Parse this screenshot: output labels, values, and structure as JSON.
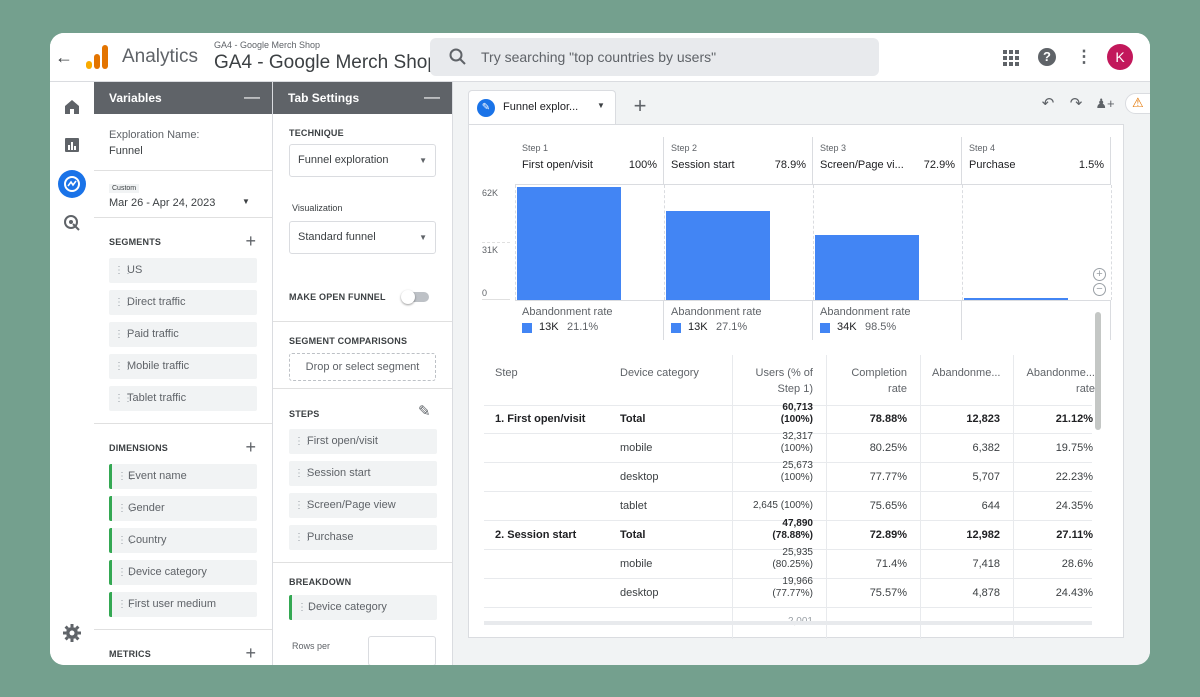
{
  "header": {
    "app_name": "Analytics",
    "property_small": "GA4 - Google Merch Shop",
    "property_big": "GA4 - Google Merch Shop",
    "search_placeholder": "Try searching \"top countries by users\"",
    "avatar_letter": "K"
  },
  "variables": {
    "title": "Variables",
    "exploration_label": "Exploration Name:",
    "exploration_name": "Funnel",
    "date_tag": "Custom",
    "date_range": "Mar 26 - Apr 24, 2023",
    "segments_label": "SEGMENTS",
    "segments": [
      "US",
      "Direct traffic",
      "Paid traffic",
      "Mobile traffic",
      "Tablet traffic"
    ],
    "dimensions_label": "DIMENSIONS",
    "dimensions": [
      "Event name",
      "Gender",
      "Country",
      "Device category",
      "First user medium"
    ],
    "metrics_label": "METRICS"
  },
  "tab_settings": {
    "title": "Tab Settings",
    "technique_label": "TECHNIQUE",
    "technique_value": "Funnel exploration",
    "visualization_label": "Visualization",
    "visualization_value": "Standard funnel",
    "open_funnel_label": "MAKE OPEN FUNNEL",
    "segment_comparisons_label": "SEGMENT COMPARISONS",
    "drop_segment": "Drop or select segment",
    "steps_label": "STEPS",
    "steps": [
      "First open/visit",
      "Session start",
      "Screen/Page view",
      "Purchase"
    ],
    "breakdown_label": "BREAKDOWN",
    "breakdown_value": "Device category",
    "rows_label": "Rows per"
  },
  "main": {
    "tab_label": "Funnel explor...",
    "funnel_steps": [
      {
        "step": "Step 1",
        "name": "First open/visit",
        "pct": "100%"
      },
      {
        "step": "Step 2",
        "name": "Session start",
        "pct": "78.9%"
      },
      {
        "step": "Step 3",
        "name": "Screen/Page vi...",
        "pct": "72.9%"
      },
      {
        "step": "Step 4",
        "name": "Purchase",
        "pct": "1.5%"
      }
    ],
    "y_ticks": [
      "62K",
      "31K",
      "0"
    ],
    "abandonment_label": "Abandonment rate",
    "abandonment": [
      {
        "count": "13K",
        "rate": "21.1%"
      },
      {
        "count": "13K",
        "rate": "27.1%"
      },
      {
        "count": "34K",
        "rate": "98.5%"
      }
    ],
    "table_headers": [
      "Step",
      "Device category",
      "Users (% of",
      "Step 1)",
      "Completion",
      "rate",
      "Abandonme...",
      "Abandonme...",
      "rate"
    ],
    "table_rows": [
      {
        "step": "1. First open/visit",
        "device": "Total",
        "users1": "60,713",
        "users2": "(100%)",
        "completion": "78.88%",
        "aband": "12,823",
        "aband_rate": "21.12%"
      },
      {
        "step": "",
        "device": "mobile",
        "users1": "32,317",
        "users2": "(100%)",
        "completion": "80.25%",
        "aband": "6,382",
        "aband_rate": "19.75%"
      },
      {
        "step": "",
        "device": "desktop",
        "users1": "25,673",
        "users2": "(100%)",
        "completion": "77.77%",
        "aband": "5,707",
        "aband_rate": "22.23%"
      },
      {
        "step": "",
        "device": "tablet",
        "users1": "2,645 (100%)",
        "users2": "",
        "completion": "75.65%",
        "aband": "644",
        "aband_rate": "24.35%"
      },
      {
        "step": "2. Session start",
        "device": "Total",
        "users1": "47,890",
        "users2": "(78.88%)",
        "completion": "72.89%",
        "aband": "12,982",
        "aband_rate": "27.11%"
      },
      {
        "step": "",
        "device": "mobile",
        "users1": "25,935",
        "users2": "(80.25%)",
        "completion": "71.4%",
        "aband": "7,418",
        "aband_rate": "28.6%"
      },
      {
        "step": "",
        "device": "desktop",
        "users1": "19,966",
        "users2": "(77.77%)",
        "completion": "75.57%",
        "aband": "4,878",
        "aband_rate": "24.43%"
      },
      {
        "step": "",
        "device": "",
        "users1": "2,001",
        "users2": "",
        "completion": "",
        "aband": "",
        "aband_rate": ""
      }
    ]
  },
  "chart_data": {
    "type": "bar",
    "categories": [
      "First open/visit",
      "Session start",
      "Screen/Page view",
      "Purchase"
    ],
    "values": [
      60713,
      47890,
      34900,
      910
    ],
    "ylim": [
      0,
      62000
    ],
    "y_ticks": [
      0,
      31000,
      62000
    ]
  },
  "colors": {
    "accent": "#1a73e8",
    "bar": "#4285f4",
    "panel_header": "#5f6368",
    "logo": "#f9ab00",
    "avatar": "#c2185b"
  }
}
